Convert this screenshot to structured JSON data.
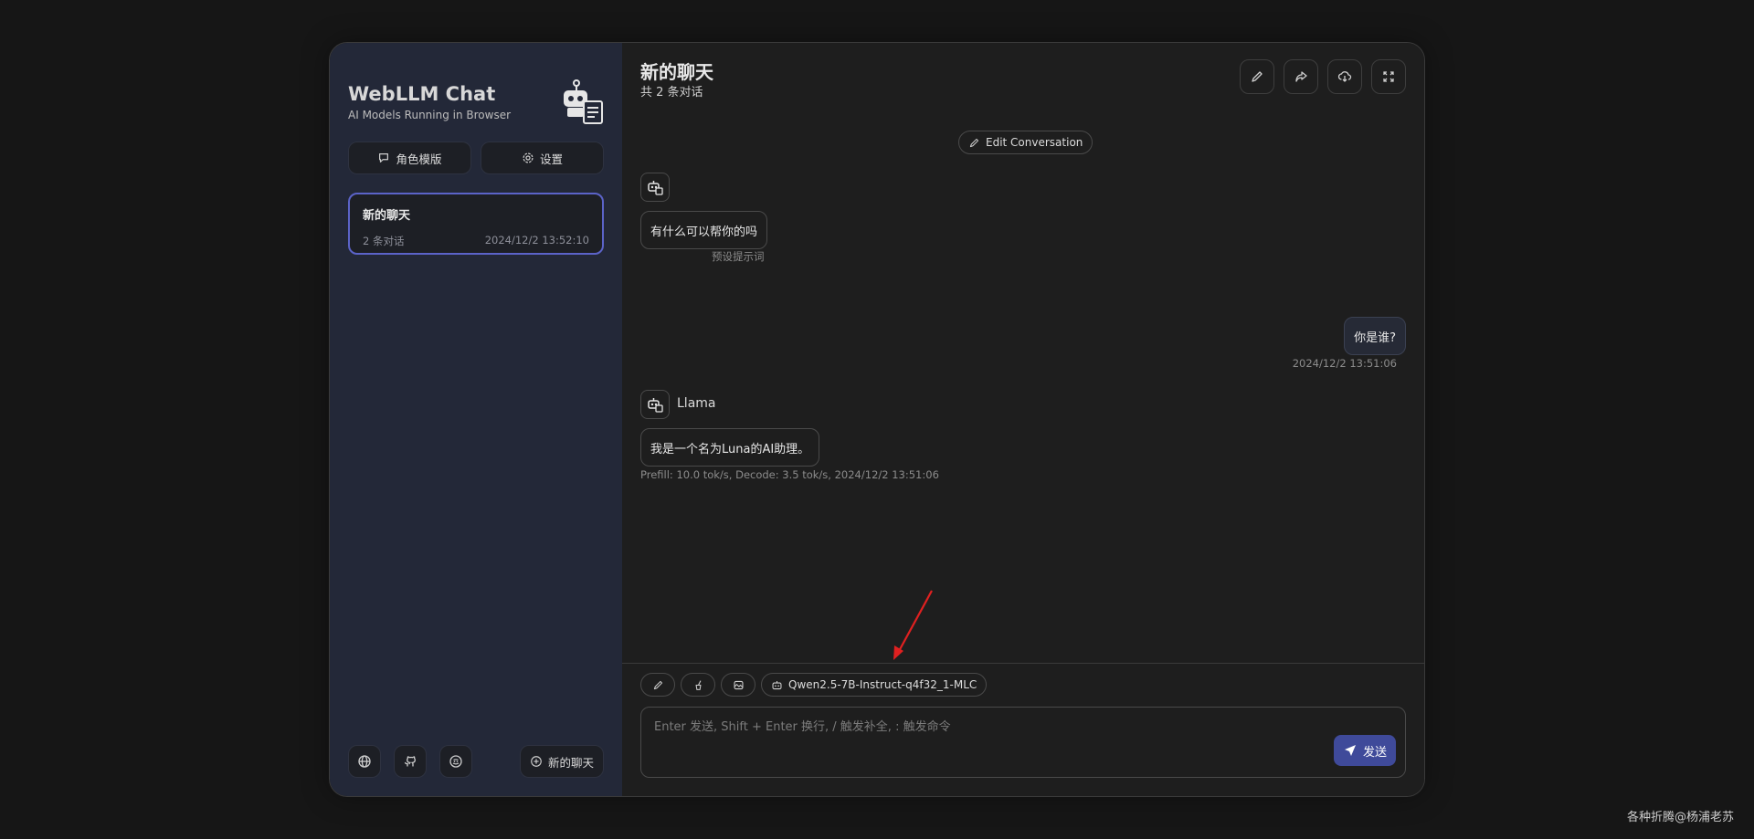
{
  "sidebar": {
    "title": "WebLLM Chat",
    "subtitle": "AI Models Running in Browser",
    "buttons": {
      "templates": "角色模版",
      "settings": "设置"
    },
    "chat": {
      "title": "新的聊天",
      "count": "2 条对话",
      "time": "2024/12/2 13:52:10"
    },
    "new_chat": "新的聊天"
  },
  "main": {
    "title": "新的聊天",
    "subtitle": "共 2 条对话",
    "edit_conversation": "Edit Conversation",
    "messages": [
      {
        "text": "有什么可以帮你的吗",
        "meta": "预设提示词"
      },
      {
        "text": "你是谁?",
        "meta": "2024/12/2 13:51:06"
      },
      {
        "sender": "Llama",
        "text": "我是一个名为Luna的AI助理。",
        "meta": "Prefill: 10.0 tok/s,  Decode: 3.5 tok/s,  2024/12/2 13:51:06"
      }
    ],
    "model_chip": "Qwen2.5-7B-Instruct-q4f32_1-MLC",
    "input_placeholder": "Enter 发送, Shift + Enter 换行, / 触发补全, : 触发命令",
    "send": "发送"
  },
  "watermark": "各种折腾@杨浦老苏",
  "colors": {
    "accent": "#5b63c8",
    "send_button": "#3f4a9a",
    "arrow": "#e02020",
    "sidebar_bg": "#232838",
    "main_bg": "#1e1e1e"
  }
}
